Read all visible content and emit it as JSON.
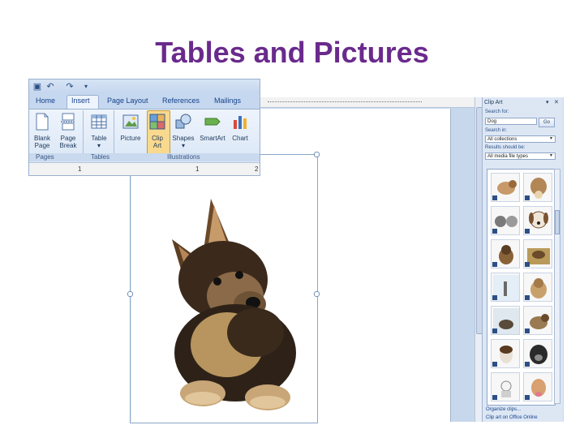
{
  "slide": {
    "title": "Tables and Pictures"
  },
  "ribbon": {
    "tabs": [
      "Home",
      "Insert",
      "Page Layout",
      "References",
      "Mailings"
    ],
    "active_tab": "Insert",
    "buttons": {
      "blank_page": [
        "Blank",
        "Page"
      ],
      "page_break": [
        "Page",
        "Break"
      ],
      "table": [
        "Table",
        "▾"
      ],
      "picture": [
        "Picture"
      ],
      "clip_art": [
        "Clip",
        "Art"
      ],
      "shapes": [
        "Shapes",
        "▾"
      ],
      "smartart": [
        "SmartArt"
      ],
      "chart": [
        "Chart"
      ]
    },
    "groups": [
      "Pages",
      "Tables",
      "Illustrations"
    ],
    "ruler_numbers": [
      "1",
      "1",
      "2"
    ]
  },
  "clip_art_pane": {
    "title": "Clip Art",
    "search_for_label": "Search for:",
    "search_value": "Dog",
    "go_label": "Go",
    "search_in_label": "Search in:",
    "search_in_value": "All collections",
    "results_label": "Results should be:",
    "results_value": "All media file types",
    "links": [
      "Organize clips...",
      "Clip art on Office Online"
    ]
  },
  "colors": {
    "title": "#6a2a8c",
    "ribbon": "#dbe6f4",
    "accent": "#15428b",
    "highlight": "#f8d98d"
  },
  "icons": [
    "save-icon",
    "undo-icon",
    "redo-icon",
    "blank-page-icon",
    "page-break-icon",
    "table-icon",
    "picture-icon",
    "clip-art-icon",
    "shapes-icon",
    "smartart-icon",
    "chart-icon",
    "close-icon",
    "dropdown-icon"
  ]
}
